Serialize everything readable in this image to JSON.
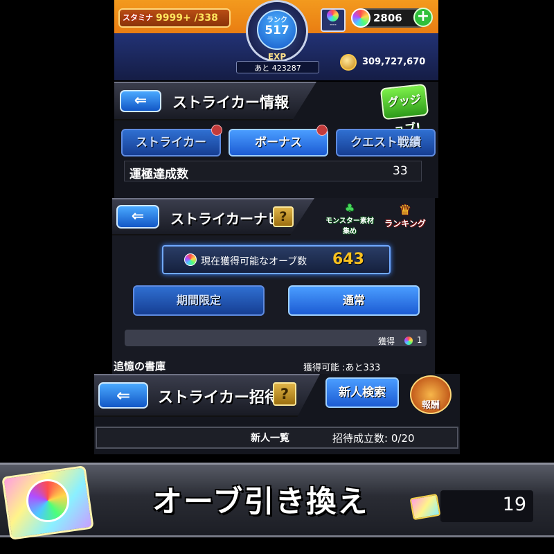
{
  "status_bar": {
    "stamina_tag": "スタミナ",
    "stamina_value": "9999+ /338",
    "rank_label": "ランク",
    "rank_value": "517",
    "exp_label": "EXP",
    "exp_remaining": "あと 423287",
    "item_slot_text": "---",
    "orb_count": "2806",
    "add_label": "+",
    "gold": "309,727,670"
  },
  "striker_info": {
    "back_label": "⇐",
    "title": "ストライカー情報",
    "good_job_label": "グッジョブ!",
    "tabs": [
      {
        "label": "ストライカー",
        "active": false
      },
      {
        "label": "ボーナス",
        "active": true
      },
      {
        "label": "クエスト戦績",
        "active": false
      }
    ],
    "row_label": "運極達成数",
    "row_value": "33"
  },
  "striker_navi": {
    "back_label": "⇐",
    "title": "ストライカーナビ",
    "help_label": "?",
    "monster_label": "モンスター素材集め",
    "ranking_label": "ランキング",
    "orb_label": "現在獲得可能なオーブ数",
    "orb_value": "643",
    "tabs": [
      {
        "label": "期間限定",
        "active": false
      },
      {
        "label": "通常",
        "active": true
      }
    ],
    "obtained_label": "獲得",
    "obtained_value": "1",
    "row2_label": "追憶の書庫",
    "row2_value": "獲得可能 :あと333"
  },
  "striker_invite": {
    "back_label": "⇐",
    "title": "ストライカー招待",
    "help_label": "?",
    "search_label": "新人検索",
    "reward_label": "報酬",
    "list_label": "新人一覧",
    "invite_status": "招待成立数: 0/20"
  },
  "banner": {
    "title": "オーブ引き換え",
    "ticket_count": "19"
  },
  "colors": {
    "accent_blue": "#1c5bd3",
    "orb_gold": "#f9c11f",
    "topbar_orange": "#f39a1e"
  }
}
